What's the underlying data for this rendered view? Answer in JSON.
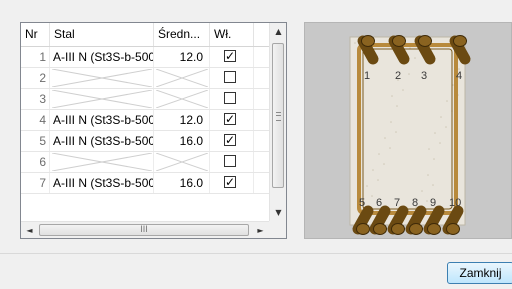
{
  "table": {
    "headers": {
      "nr": "Nr",
      "steel": "Stal",
      "diameter": "Średn...",
      "own": "Wł."
    },
    "rows": [
      {
        "nr": "1",
        "steel": "A-III N (St3S-b-500",
        "diameter": "12.0",
        "checked": true,
        "empty": false
      },
      {
        "nr": "2",
        "steel": "",
        "diameter": "",
        "checked": false,
        "empty": true
      },
      {
        "nr": "3",
        "steel": "",
        "diameter": "",
        "checked": false,
        "empty": true
      },
      {
        "nr": "4",
        "steel": "A-III N (St3S-b-500",
        "diameter": "12.0",
        "checked": true,
        "empty": false
      },
      {
        "nr": "5",
        "steel": "A-III N (St3S-b-500",
        "diameter": "16.0",
        "checked": true,
        "empty": false
      },
      {
        "nr": "6",
        "steel": "",
        "diameter": "",
        "checked": false,
        "empty": true
      },
      {
        "nr": "7",
        "steel": "A-III N (St3S-b-500",
        "diameter": "16.0",
        "checked": true,
        "empty": false
      }
    ],
    "scroll": {
      "up_icon": "▲",
      "down_icon": "▼",
      "left_icon": "◄",
      "right_icon": "►",
      "h_grip": "III"
    }
  },
  "preview": {
    "top_bar_labels": [
      "1",
      "2",
      "3",
      "4"
    ],
    "bottom_bar_labels": [
      "5",
      "6",
      "7",
      "8",
      "9",
      "10"
    ],
    "colors": {
      "background": "#c8c8c8",
      "concrete": "#e9e5dc",
      "rebar": "#6b4a12",
      "stirrup": "#b88a3c"
    }
  },
  "buttons": {
    "close_label": "Zamknij"
  }
}
